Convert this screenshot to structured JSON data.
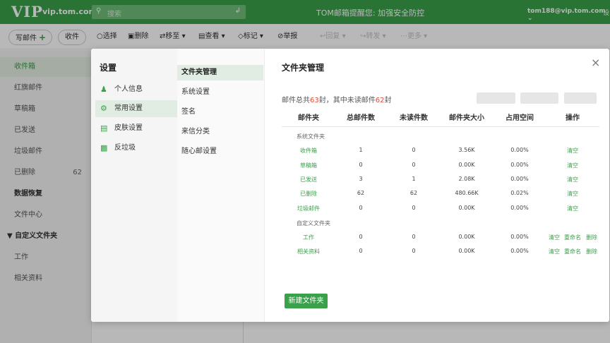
{
  "header": {
    "logo": "VIP",
    "domain": "vip.tom.com",
    "search_placeholder": "搜索",
    "notice": "TOM邮箱提醒您: 加强安全防控",
    "user": "tom188@vip.tom.com",
    "settings_fragment": "设"
  },
  "toolbar": {
    "compose": "写邮件",
    "receive": "收件",
    "select": "选择",
    "delete": "删除",
    "move": "移至",
    "view": "查看",
    "mark": "标记",
    "report": "举报",
    "reply": "回复",
    "forward": "转发",
    "more": "更多"
  },
  "sidebar": {
    "inbox": "收件箱",
    "flagged": "红旗邮件",
    "drafts": "草稿箱",
    "sent": "已发送",
    "spam": "垃圾邮件",
    "deleted": "已删除",
    "deleted_count": "62",
    "recovery": "数据恢复",
    "file_center": "文件中心",
    "custom_folders": "自定义文件夹",
    "custom_items": [
      "工作",
      "相关资料"
    ]
  },
  "modal": {
    "title": "设置",
    "nav": [
      "个人信息",
      "常用设置",
      "皮肤设置",
      "反垃圾"
    ],
    "subnav": [
      "文件夹管理",
      "系统设置",
      "签名",
      "来信分类",
      "随心邮设置"
    ],
    "content_title": "文件夹管理",
    "summary_prefix": "邮件总共",
    "summary_total": "63",
    "summary_mid": "封，其中未读邮件",
    "summary_unread": "62",
    "summary_suffix": "封",
    "columns": [
      "邮件夹",
      "总邮件数",
      "未读件数",
      "邮件夹大小",
      "占用空间",
      "操作"
    ],
    "system_group": "系统文件夹",
    "custom_group": "自定义文件夹",
    "system_rows": [
      {
        "name": "收件箱",
        "total": "1",
        "unread": "0",
        "size": "3.56K",
        "space": "0.00%",
        "op": "清空"
      },
      {
        "name": "草稿箱",
        "total": "0",
        "unread": "0",
        "size": "0.00K",
        "space": "0.00%",
        "op": "清空"
      },
      {
        "name": "已发送",
        "total": "3",
        "unread": "1",
        "size": "2.08K",
        "space": "0.00%",
        "op": "清空"
      },
      {
        "name": "已删除",
        "total": "62",
        "unread": "62",
        "size": "480.66K",
        "space": "0.02%",
        "op": "清空"
      },
      {
        "name": "垃圾邮件",
        "total": "0",
        "unread": "0",
        "size": "0.00K",
        "space": "0.00%",
        "op": "清空"
      }
    ],
    "custom_rows": [
      {
        "name": "工作",
        "total": "0",
        "unread": "0",
        "size": "0.00K",
        "space": "0.00%",
        "op1": "清空",
        "op2": "重命名",
        "op3": "删除"
      },
      {
        "name": "相关资料",
        "total": "0",
        "unread": "0",
        "size": "0.00K",
        "space": "0.00%",
        "op1": "清空",
        "op2": "重命名",
        "op3": "删除"
      }
    ],
    "new_folder": "新建文件夹",
    "close_icon": "×"
  },
  "colors": {
    "brand": "#3aa04a",
    "accent_red": "#e24b3a"
  }
}
